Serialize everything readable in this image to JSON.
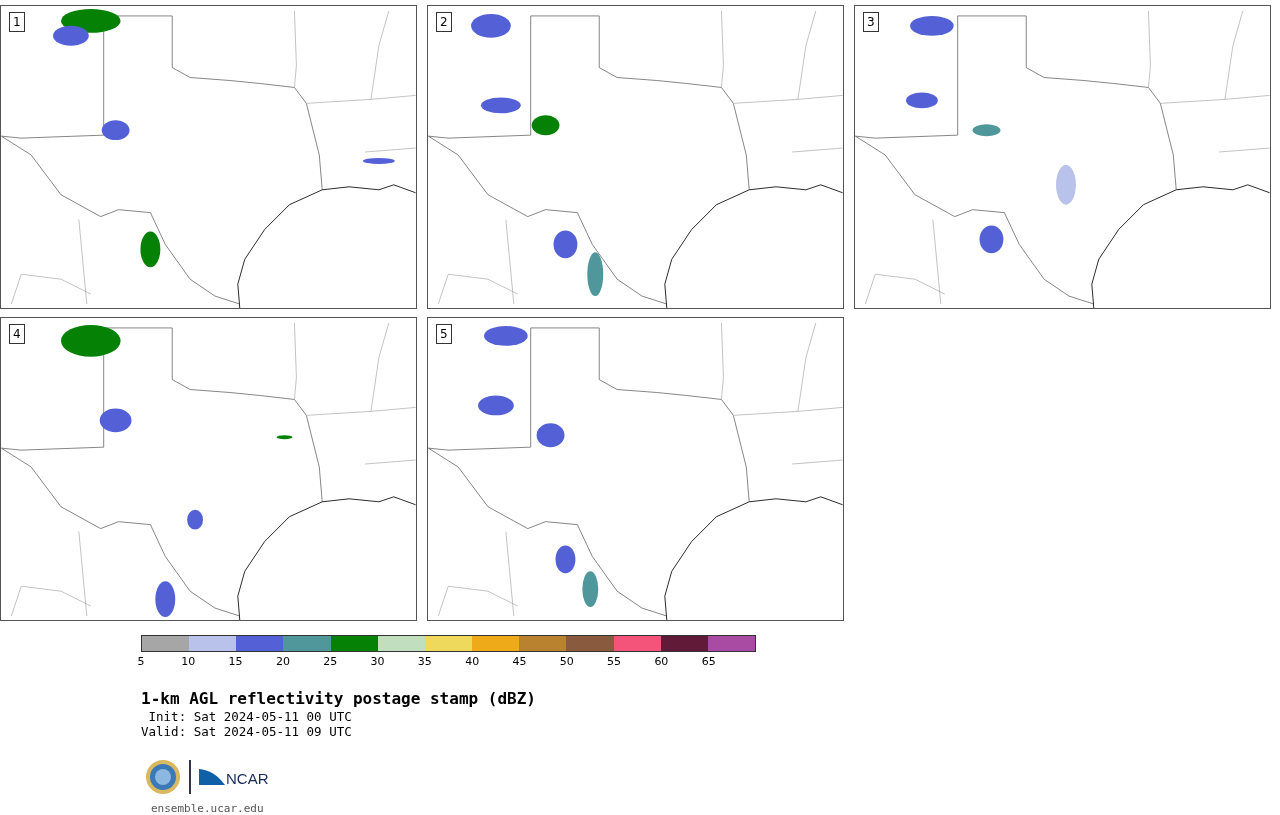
{
  "panels": [
    {
      "label": "1"
    },
    {
      "label": "2"
    },
    {
      "label": "3"
    },
    {
      "label": "4"
    },
    {
      "label": "5"
    }
  ],
  "colorbar": {
    "segments": [
      {
        "color": "#a6a6a6"
      },
      {
        "color": "#b8c2eb"
      },
      {
        "color": "#5461d6"
      },
      {
        "color": "#50979c"
      },
      {
        "color": "#058205"
      },
      {
        "color": "#c1dfbf"
      },
      {
        "color": "#efd95d"
      },
      {
        "color": "#efaa19"
      },
      {
        "color": "#b8822f"
      },
      {
        "color": "#8a5a3e"
      },
      {
        "color": "#f45479"
      },
      {
        "color": "#621a39"
      },
      {
        "color": "#aa4ba3"
      }
    ],
    "ticks": [
      "5",
      "10",
      "15",
      "20",
      "25",
      "30",
      "35",
      "40",
      "45",
      "50",
      "55",
      "60",
      "65"
    ]
  },
  "title": "1-km AGL reflectivity postage stamp (dBZ)",
  "init": " Init: Sat 2024-05-11 00 UTC",
  "valid": "Valid: Sat 2024-05-11 09 UTC",
  "logo_text": "NCAR",
  "url": "ensemble.ucar.edu"
}
